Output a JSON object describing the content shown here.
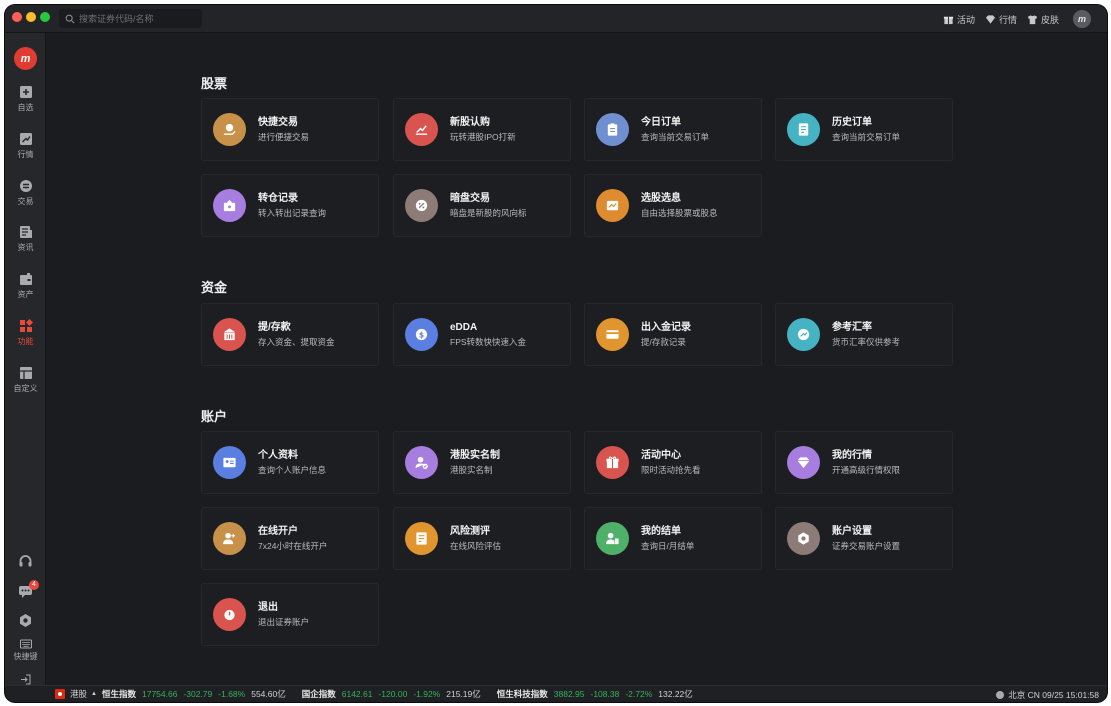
{
  "titlebar": {
    "search_placeholder": "搜索证券代码/名称",
    "activity_label": "活动",
    "market_label": "行情",
    "skin_label": "皮肤",
    "avatar_text": "m"
  },
  "colors": {
    "accent": "#e64a3b",
    "negative": "#32b35a",
    "background": "#1b1c20"
  },
  "sidebar": {
    "logo_text": "m",
    "items": [
      {
        "label": "自选",
        "icon": "plus-square-icon"
      },
      {
        "label": "行情",
        "icon": "chart-trend-icon"
      },
      {
        "label": "交易",
        "icon": "exchange-icon"
      },
      {
        "label": "资讯",
        "icon": "news-icon"
      },
      {
        "label": "资产",
        "icon": "wallet-icon"
      },
      {
        "label": "功能",
        "icon": "grid-icon",
        "active": true
      },
      {
        "label": "自定义",
        "icon": "layout-icon"
      }
    ],
    "bottom": {
      "support_icon": "headset-icon",
      "message_icon": "chat-icon",
      "message_badge": "4",
      "settings_icon": "hexagon-gear-icon",
      "shortcut_label": "快捷键",
      "login_label": "登录"
    }
  },
  "sections": {
    "stocks": {
      "title": "股票",
      "cards": [
        {
          "title": "快捷交易",
          "desc": "进行便捷交易",
          "color": "#c8914a",
          "icon": "coin-hand-icon"
        },
        {
          "title": "新股认购",
          "desc": "玩转港股IPO打新",
          "color": "#d9534f",
          "icon": "rising-chart-icon"
        },
        {
          "title": "今日订单",
          "desc": "查询当前交易订单",
          "color": "#6f8fd1",
          "icon": "clipboard-icon"
        },
        {
          "title": "历史订单",
          "desc": "查询当前交易订单",
          "color": "#45b3c4",
          "icon": "document-icon"
        },
        {
          "title": "转仓记录",
          "desc": "转入转出记录查询",
          "color": "#a77de0",
          "icon": "transfer-box-icon"
        },
        {
          "title": "暗盘交易",
          "desc": "暗盘是新股的风向标",
          "color": "#8c7b77",
          "icon": "percent-icon"
        },
        {
          "title": "选股选息",
          "desc": "自由选择股票或股息",
          "color": "#df8b2f",
          "icon": "picture-chart-icon"
        }
      ]
    },
    "funds": {
      "title": "资金",
      "cards": [
        {
          "title": "提/存款",
          "desc": "存入资金、提取资金",
          "color": "#d9534f",
          "icon": "bank-icon"
        },
        {
          "title": "eDDA",
          "desc": "FPS转数快快速入金",
          "color": "#5b7fe0",
          "icon": "dollar-coin-icon"
        },
        {
          "title": "出入金记录",
          "desc": "提/存款记录",
          "color": "#e0952f",
          "icon": "card-icon"
        },
        {
          "title": "参考汇率",
          "desc": "货币汇率仅供参考",
          "color": "#45b3c4",
          "icon": "rate-icon"
        }
      ]
    },
    "account": {
      "title": "账户",
      "cards": [
        {
          "title": "个人资料",
          "desc": "查询个人账户信息",
          "color": "#5b7fe0",
          "icon": "id-card-icon"
        },
        {
          "title": "港股实名制",
          "desc": "港股实名制",
          "color": "#a77de0",
          "icon": "verified-user-icon"
        },
        {
          "title": "活动中心",
          "desc": "限时活动抢先看",
          "color": "#d9534f",
          "icon": "gift-icon"
        },
        {
          "title": "我的行情",
          "desc": "开通高级行情权限",
          "color": "#a77de0",
          "icon": "diamond-icon"
        },
        {
          "title": "在线开户",
          "desc": "7x24小时在线开户",
          "color": "#c8914a",
          "icon": "add-user-icon"
        },
        {
          "title": "风险测评",
          "desc": "在线风险评估",
          "color": "#e0952f",
          "icon": "checklist-icon"
        },
        {
          "title": "我的结单",
          "desc": "查询日/月结单",
          "color": "#4fb06a",
          "icon": "user-doc-icon"
        },
        {
          "title": "账户设置",
          "desc": "证券交易账户设置",
          "color": "#8c7b77",
          "icon": "settings-icon"
        },
        {
          "title": "退出",
          "desc": "退出证券账户",
          "color": "#d9534f",
          "icon": "power-icon"
        }
      ]
    }
  },
  "statusbar": {
    "market": "港股",
    "indices": [
      {
        "name": "恒生指数",
        "price": "17754.66",
        "change": "-302.79",
        "pct": "-1.68%",
        "turnover": "554.60亿"
      },
      {
        "name": "国企指数",
        "price": "6142.61",
        "change": "-120.00",
        "pct": "-1.92%",
        "turnover": "215.19亿"
      },
      {
        "name": "恒生科技指数",
        "price": "3882.95",
        "change": "-108.38",
        "pct": "-2.72%",
        "turnover": "132.22亿"
      }
    ],
    "clock": "北京 CN 09/25 15:01:58"
  }
}
